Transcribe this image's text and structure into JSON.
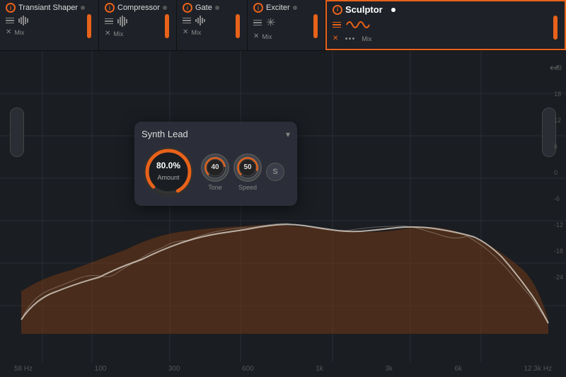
{
  "topBar": {
    "modules": [
      {
        "id": "transient-shaper",
        "name": "Transiant Shaper",
        "active": false,
        "mix": "Mix"
      },
      {
        "id": "compressor",
        "name": "Compressor",
        "active": false,
        "mix": "Mix"
      },
      {
        "id": "gate",
        "name": "Gate",
        "active": false,
        "mix": "Mix"
      },
      {
        "id": "exciter",
        "name": "Exciter",
        "active": false,
        "mix": "Mix"
      },
      {
        "id": "sculptor",
        "name": "Sculptor",
        "active": true,
        "mix": "Mix"
      }
    ]
  },
  "popup": {
    "presetName": "Synth Lead",
    "amount": {
      "value": "80.0%",
      "label": "Amount"
    },
    "tone": {
      "value": "40",
      "label": "Tone"
    },
    "speed": {
      "value": "50",
      "label": "Speed"
    },
    "sButton": "S"
  },
  "freqLabels": [
    "58 Hz",
    "100",
    "300",
    "600",
    "1k",
    "3k",
    "6k",
    "12.3k Hz"
  ],
  "dbLabels": [
    "dB",
    "18",
    "12",
    "6",
    "0",
    "-6",
    "-12",
    "-18",
    "-24"
  ],
  "scrollbar": {
    "thumbLeft": "30%",
    "thumbWidth": "40%"
  },
  "colors": {
    "accent": "#e8621a",
    "bg": "#1a1d22",
    "moduleBg": "#1e2128",
    "popupBg": "#2b2e38"
  }
}
